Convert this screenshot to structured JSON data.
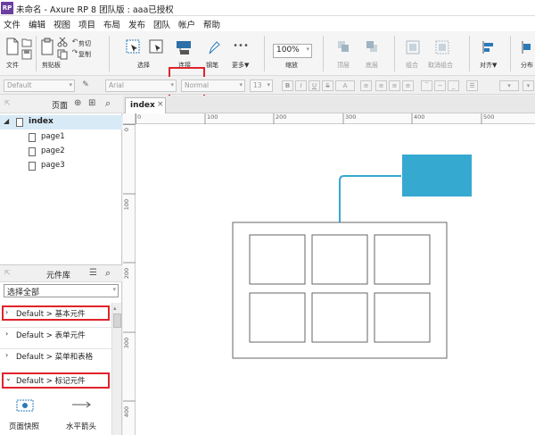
{
  "window": {
    "title": "未命名 - Axure RP 8 团队版 : aaa已授权",
    "logo": "RP"
  },
  "menu": [
    "文件",
    "编辑",
    "视图",
    "项目",
    "布局",
    "发布",
    "团队",
    "帐户",
    "帮助"
  ],
  "toolbar": {
    "file": "文件",
    "clipboard": "剪贴板",
    "cut": "剪切",
    "copy": "复制",
    "select": "选择",
    "connect": "连接",
    "pen": "钢笔",
    "more": "更多▼",
    "zoom_value": "100%",
    "zoom_label": "缩放",
    "top": "顶层",
    "bottom": "底层",
    "group": "组合",
    "ungroup": "取消组合",
    "align": "对齐▼",
    "distribute": "分布"
  },
  "formatbar": {
    "style": "Default",
    "font": "Arial",
    "weight": "Normal",
    "size": "13",
    "bold": "B",
    "italic": "I",
    "underline": "U",
    "strike": "S",
    "fontcolor": "A"
  },
  "pages_panel": {
    "title": "页面",
    "root": "index",
    "children": [
      "page1",
      "page2",
      "page3"
    ]
  },
  "library_panel": {
    "title": "元件库",
    "select_value": "选择全部",
    "groups": [
      "Default > 基本元件",
      "Default > 表单元件",
      "Default > 菜单和表格",
      "Default > 标记元件"
    ],
    "items": [
      "页面快照",
      "水平箭头"
    ]
  },
  "canvas": {
    "tab": "index",
    "ruler_h": [
      "0",
      "100",
      "200",
      "300",
      "400",
      "500"
    ],
    "ruler_v": [
      "0",
      "100",
      "200",
      "300",
      "400"
    ]
  },
  "colors": {
    "accent": "#36a9d1",
    "highlight": "#e0232a"
  }
}
